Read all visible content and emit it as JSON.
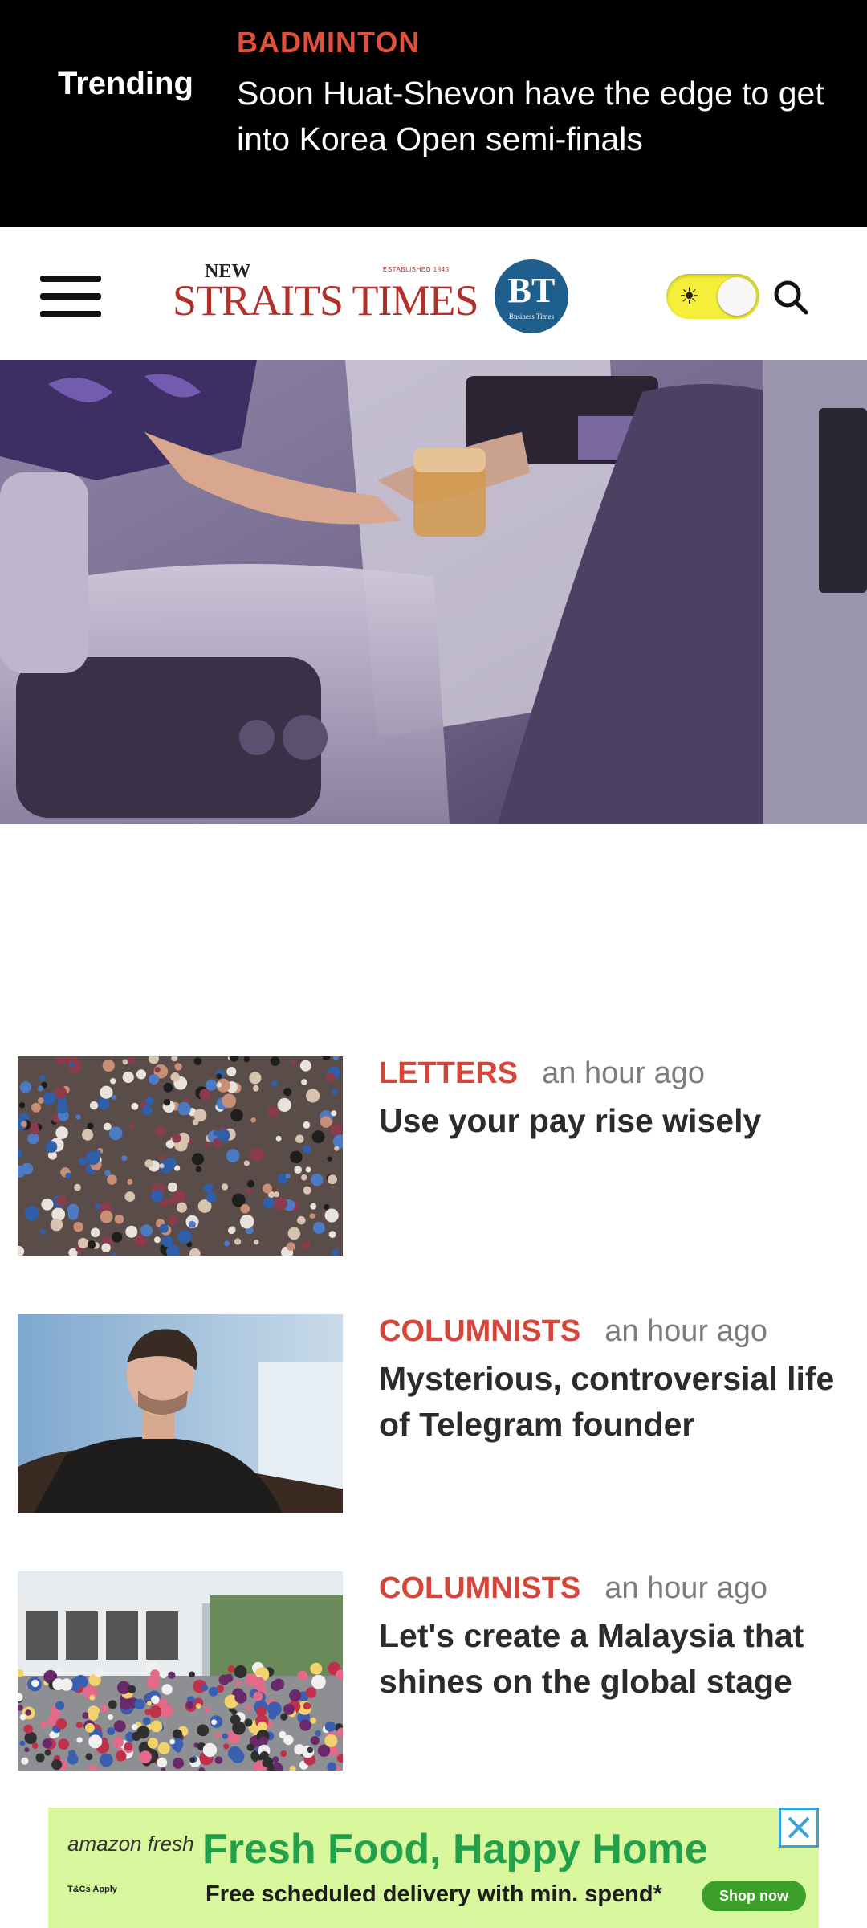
{
  "trending": {
    "label": "Trending",
    "category": "BADMINTON",
    "title": "Soon Huat-Shevon have the edge to get into Korea Open semi-finals"
  },
  "header": {
    "logo_new": "NEW",
    "logo_established": "ESTABLISHED 1845",
    "logo_main": "STRAITS TIMES",
    "bt_logo": "BT",
    "bt_logo_sub": "Business Times"
  },
  "articles": [
    {
      "category": "LETTERS",
      "time": "an hour ago",
      "headline": "Use your pay rise wisely"
    },
    {
      "category": "COLUMNISTS",
      "time": "an hour ago",
      "headline": "Mysterious, controversial life of Telegram founder"
    },
    {
      "category": "COLUMNISTS",
      "time": "an hour ago",
      "headline": "Let's create a Malaysia that shines on the global stage"
    }
  ],
  "ad": {
    "brand": "amazon fresh",
    "title": "Fresh Food, Happy Home",
    "fine_print": "T&Cs Apply",
    "subtitle": "Free scheduled delivery with min. spend*",
    "cta": "Shop now"
  },
  "colors": {
    "accent_red": "#d2473a",
    "bt_blue": "#1f5f8e",
    "toggle_yellow": "#f6ef3a",
    "ad_green": "#d9f79c"
  }
}
